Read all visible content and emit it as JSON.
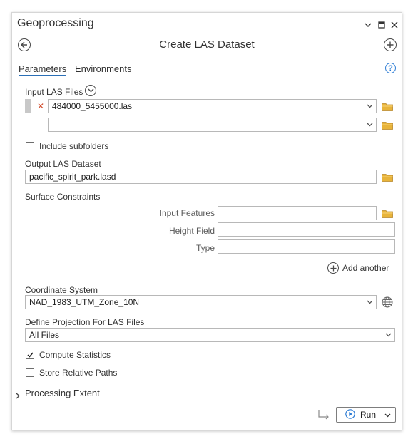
{
  "window": {
    "title": "Geoprocessing"
  },
  "header": {
    "title": "Create LAS Dataset"
  },
  "tabs": [
    {
      "label": "Parameters",
      "active": true
    },
    {
      "label": "Environments",
      "active": false
    }
  ],
  "input_las": {
    "label": "Input LAS Files",
    "value": "484000_5455000.las",
    "empty_value": ""
  },
  "include_subfolders": {
    "label": "Include subfolders",
    "checked": false
  },
  "output": {
    "label": "Output LAS Dataset",
    "value": "pacific_spirit_park.lasd"
  },
  "surface": {
    "label": "Surface Constraints",
    "input_features_label": "Input Features",
    "height_field_label": "Height Field",
    "type_label": "Type",
    "add_another_label": "Add another"
  },
  "coordinate_system": {
    "label": "Coordinate System",
    "value": "NAD_1983_UTM_Zone_10N"
  },
  "define_projection": {
    "label": "Define Projection For LAS Files",
    "value": "All Files"
  },
  "compute_statistics": {
    "label": "Compute Statistics",
    "checked": true
  },
  "store_relative": {
    "label": "Store Relative Paths",
    "checked": false
  },
  "processing_extent": {
    "label": "Processing Extent"
  },
  "footer": {
    "run_label": "Run"
  },
  "colors": {
    "accent": "#2b6fb6",
    "folder": "#e8b43a",
    "remove": "#d14b2b"
  }
}
